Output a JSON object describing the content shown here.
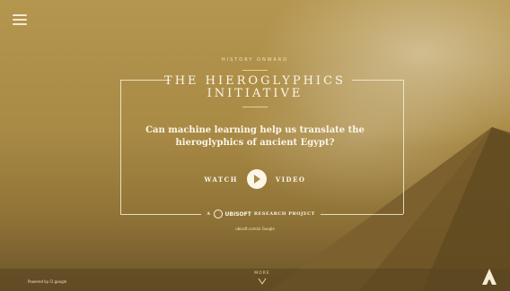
{
  "header": {
    "menu_icon": "hamburger-menu-icon",
    "eyebrow": "HISTORY ONWARD",
    "title_line1": "THE HIEROGLYPHICS",
    "title_line2": "INITIATIVE"
  },
  "main": {
    "question": "Can machine learning help us translate the hieroglyphics of ancient Egypt?",
    "watch_label": "WATCH",
    "video_label": "VIDEO",
    "project_prefix": "A",
    "project_brand": "UBISOFT",
    "project_suffix": "RESEARCH PROJECT",
    "partners": "ubisoft.com/ai  Google"
  },
  "footer": {
    "powered_by": "Powered by Cl.google",
    "more_label": "MORE",
    "more_icon": "chevron-down-icon",
    "logo_icon": "assassins-creed-logo-icon"
  },
  "colors": {
    "accent": "#e8cf8a",
    "text": "#fbf6e8",
    "background": "#a98a47"
  }
}
